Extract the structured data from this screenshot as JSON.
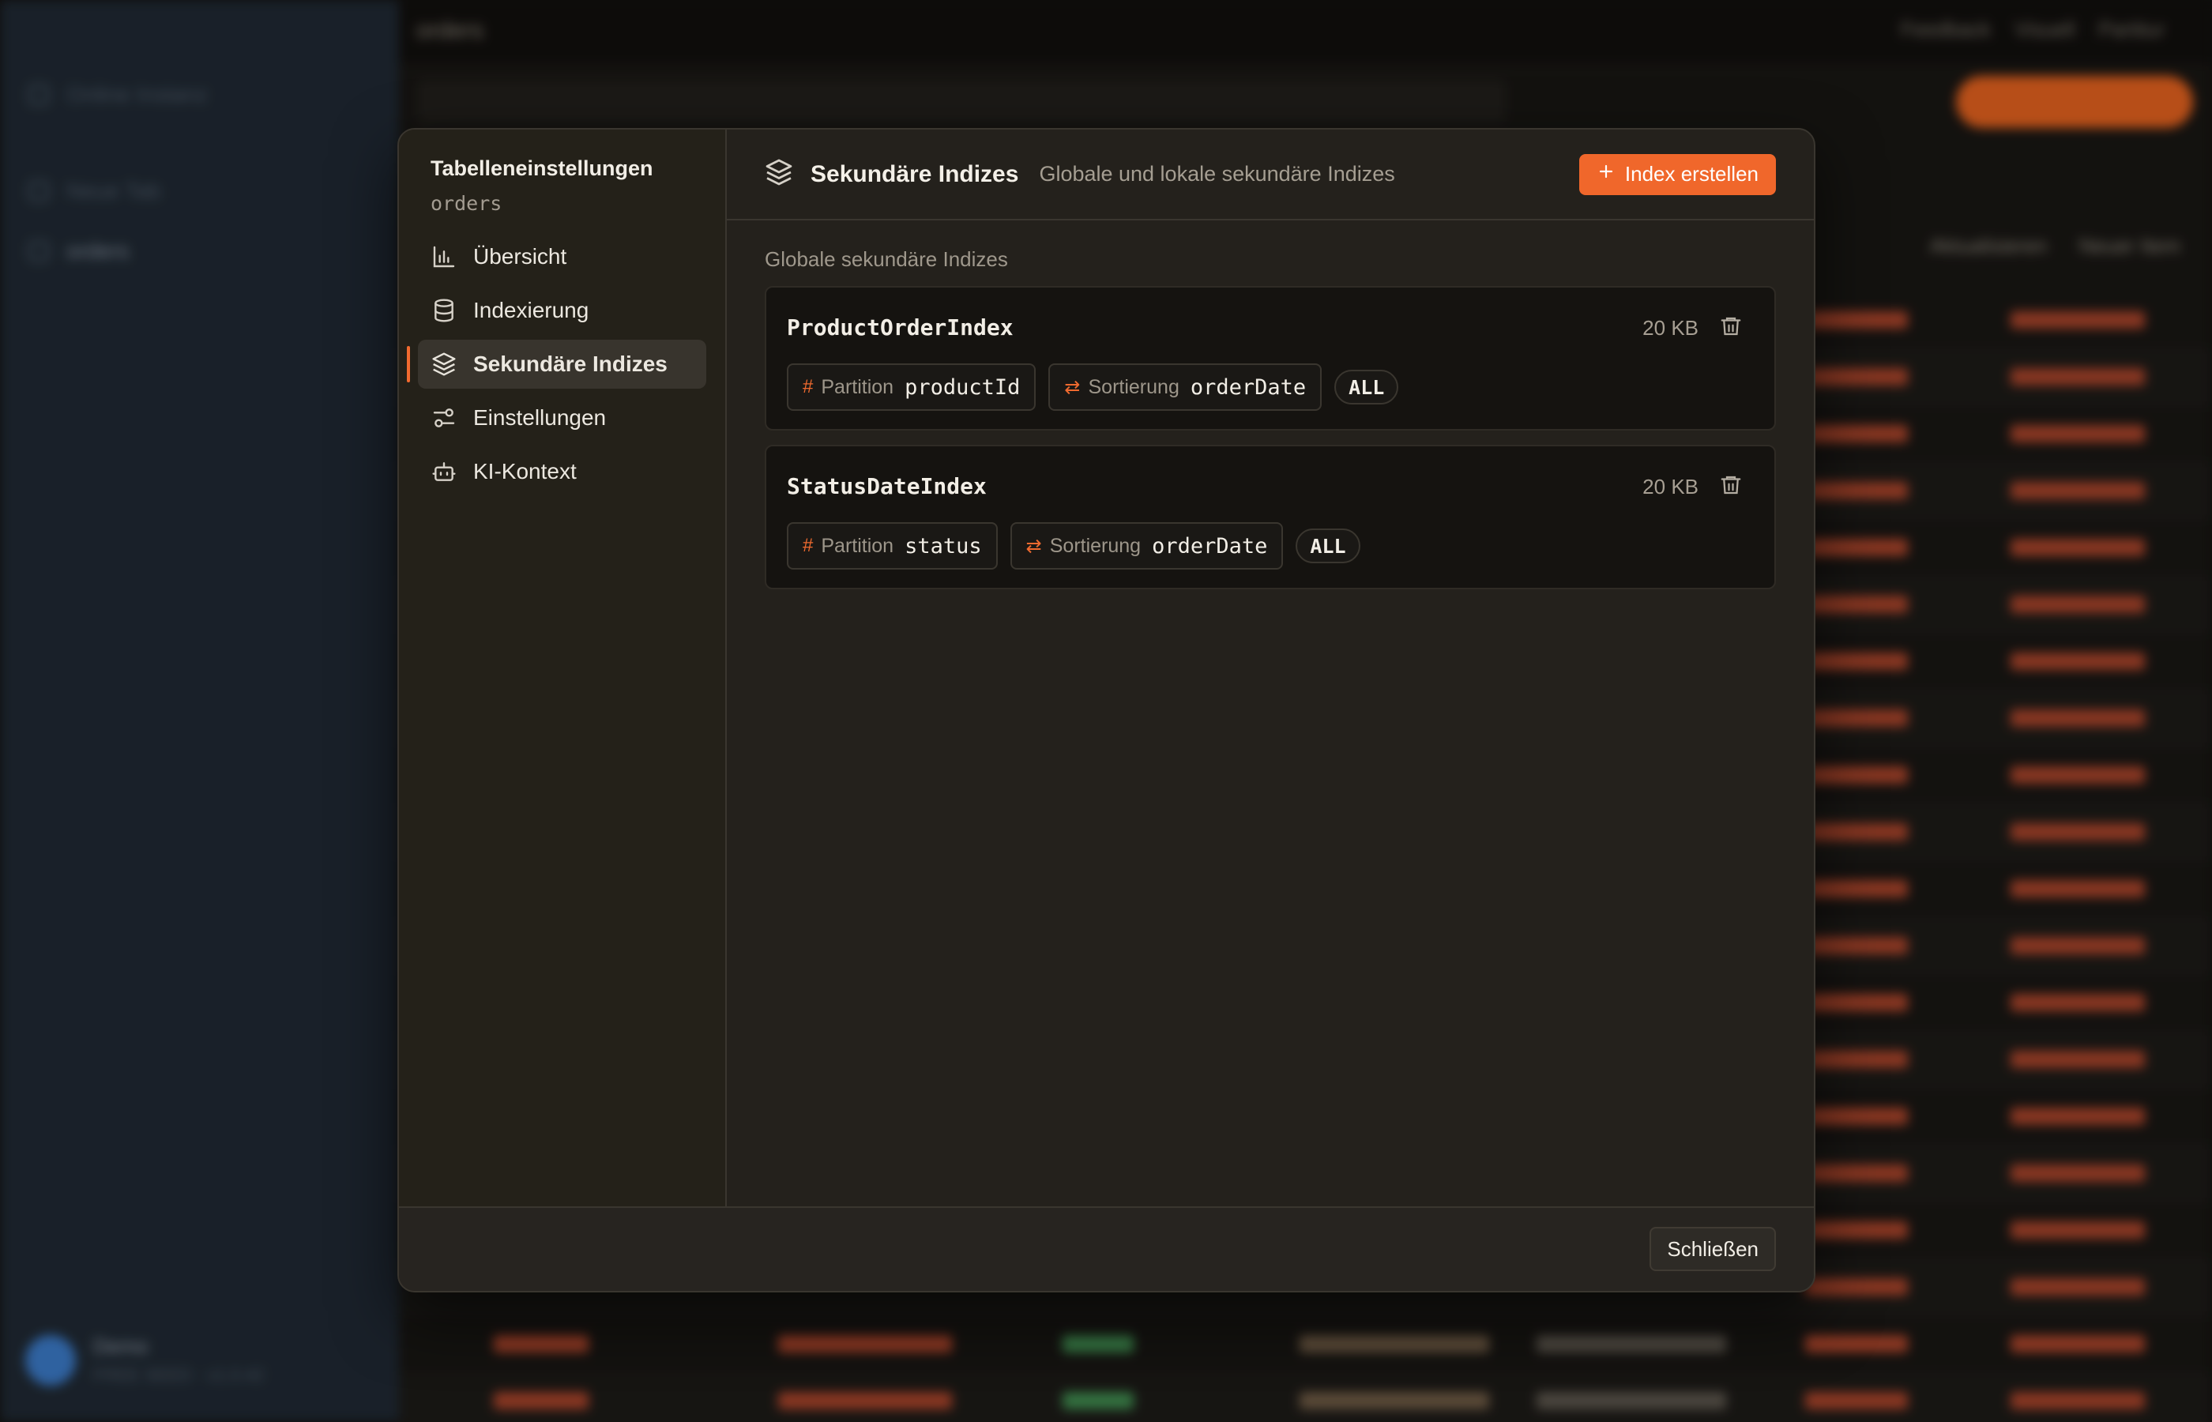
{
  "background": {
    "sidebar": {
      "items": [
        "Online Instanz",
        "Neue Tab",
        "orders"
      ]
    },
    "user": {
      "name": "Demo",
      "meta": "FREE SEED · v1.0.42"
    },
    "topbar": {
      "title": "orders",
      "right": [
        "Feedback",
        "Visuell",
        "Partitur"
      ]
    },
    "actions": [
      "Aktualisieren",
      "Neuer Item"
    ]
  },
  "modal": {
    "nav": {
      "title": "Tabelleneinstellungen",
      "subtitle": "orders",
      "items": [
        {
          "label": "Übersicht",
          "icon": "bar-chart-icon"
        },
        {
          "label": "Indexierung",
          "icon": "database-icon"
        },
        {
          "label": "Sekundäre Indizes",
          "icon": "layers-icon"
        },
        {
          "label": "Einstellungen",
          "icon": "sliders-icon"
        },
        {
          "label": "KI-Kontext",
          "icon": "bot-icon"
        }
      ],
      "active_index": 2
    },
    "header": {
      "title": "Sekundäre Indizes",
      "description": "Globale und lokale sekundäre Indizes",
      "create_button": "Index erstellen"
    },
    "section_label": "Globale sekundäre Indizes",
    "indexes": [
      {
        "name": "ProductOrderIndex",
        "size": "20 KB",
        "partition_label": "Partition",
        "partition_key": "productId",
        "sort_label": "Sortierung",
        "sort_key": "orderDate",
        "projection": "ALL"
      },
      {
        "name": "StatusDateIndex",
        "size": "20 KB",
        "partition_label": "Partition",
        "partition_key": "status",
        "sort_label": "Sortierung",
        "sort_key": "orderDate",
        "projection": "ALL"
      }
    ],
    "footer": {
      "close_button": "Schließen"
    }
  },
  "colors": {
    "accent": "#f0672b",
    "modal_bg": "#24211c",
    "card_bg": "#151310"
  }
}
